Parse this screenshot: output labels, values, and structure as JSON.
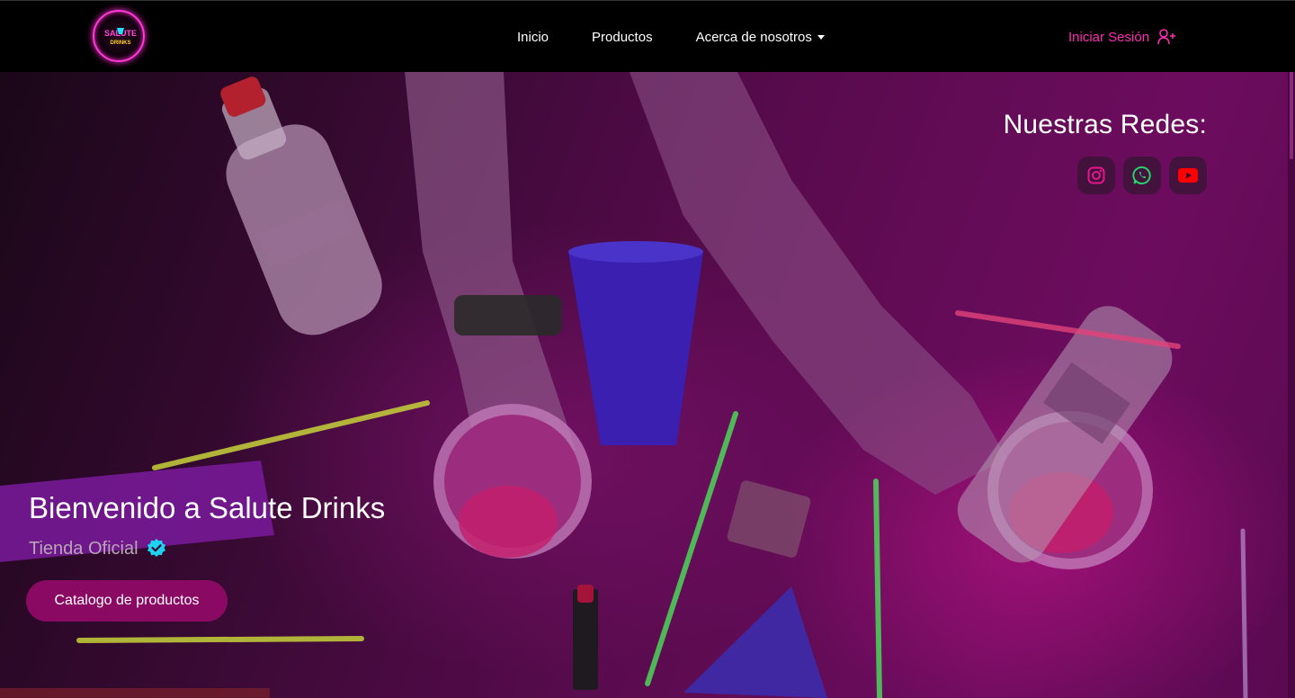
{
  "brand": {
    "logo_text_top": "SALUTE",
    "logo_text_bottom": "DRINKS"
  },
  "nav": {
    "items": [
      {
        "label": "Inicio"
      },
      {
        "label": "Productos"
      },
      {
        "label": "Acerca de nosotros"
      }
    ],
    "login_label": "Iniciar Sesión"
  },
  "socials": {
    "title": "Nuestras Redes:",
    "items": [
      {
        "icon": "instagram-icon",
        "color": "#e4168c"
      },
      {
        "icon": "whatsapp-icon",
        "color": "#25d366"
      },
      {
        "icon": "youtube-icon",
        "color": "#ff0000"
      }
    ]
  },
  "hero": {
    "title": "Bienvenido a Salute Drinks",
    "subtitle": "Tienda Oficial",
    "cta_label": "Catalogo de productos"
  },
  "colors": {
    "accent": "#ff2bb5",
    "button": "#8a0a63",
    "verified": "#1fd3f0"
  }
}
